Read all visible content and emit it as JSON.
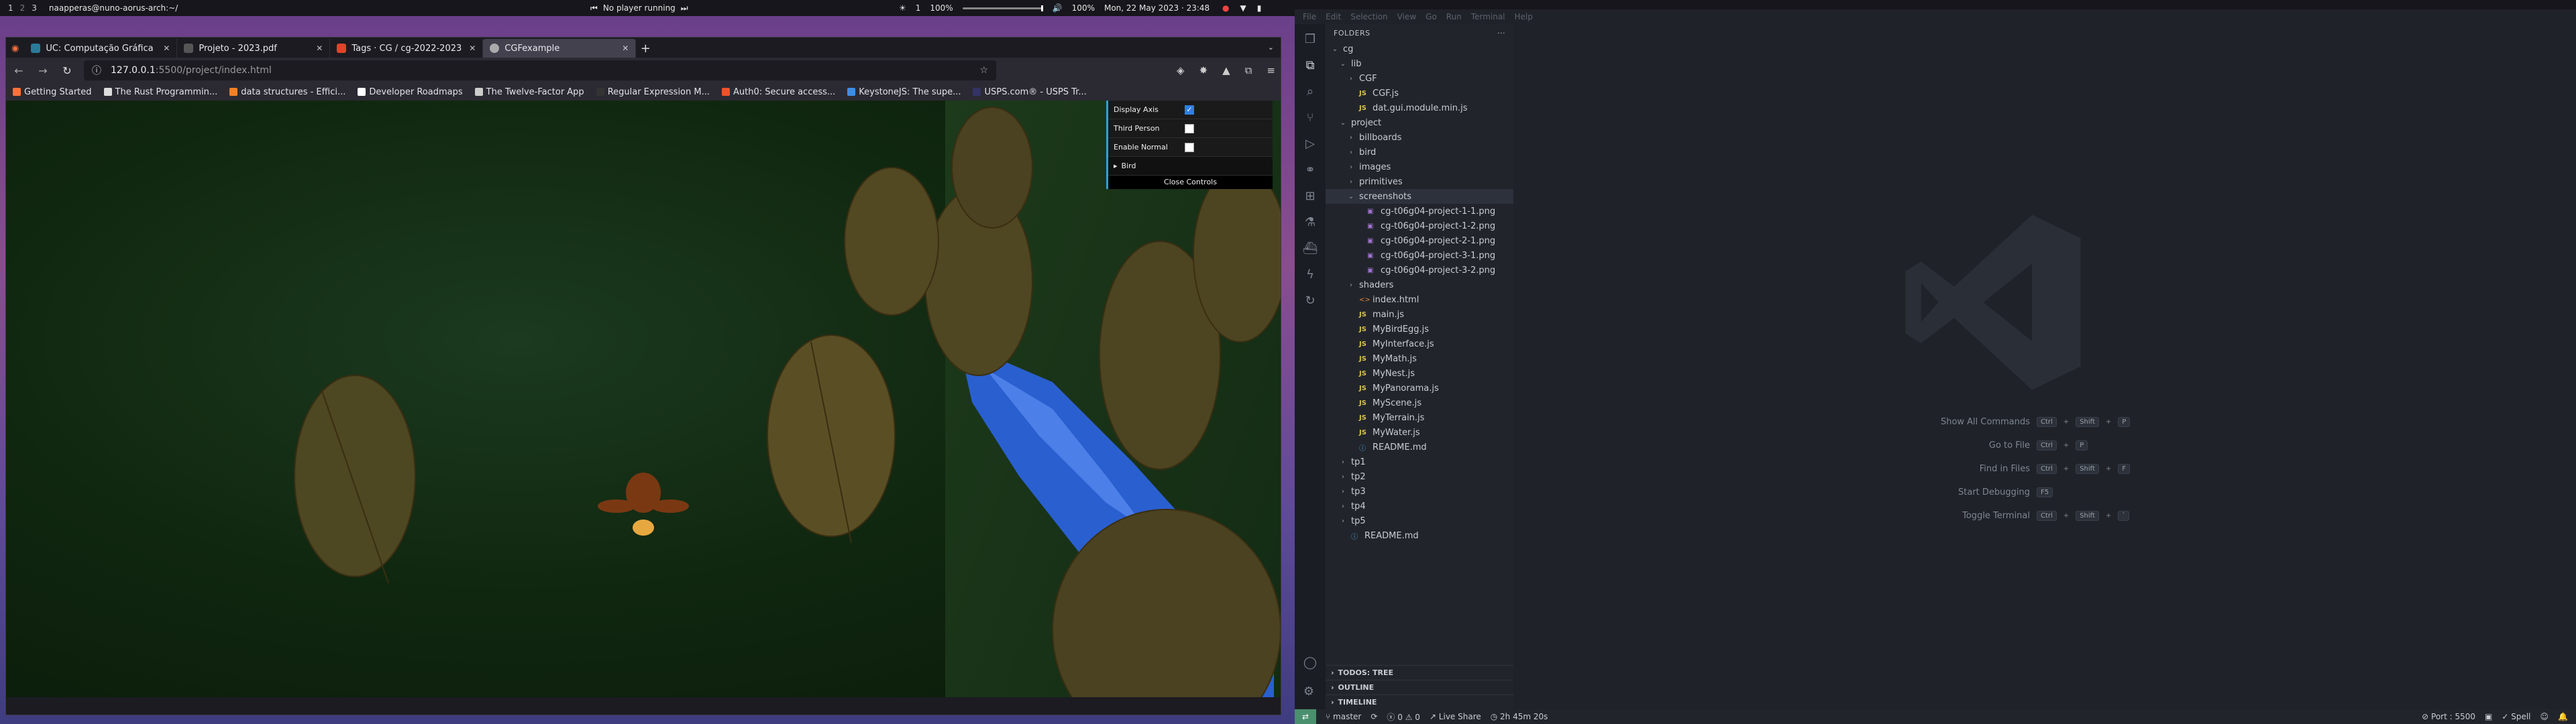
{
  "topbar": {
    "workspaces": [
      "1",
      "2",
      "3"
    ],
    "window_title": "naapperas@nuno-aorus-arch:~/",
    "media": "No player running",
    "brightness_value": "1",
    "brightness_pct": "100%",
    "volume_pct": "100%",
    "datetime": "Mon, 22 May 2023 · 23:48",
    "volume_level": 1.0
  },
  "browser": {
    "tabs": [
      {
        "label": "UC: Computação Gráfica",
        "favicon": "ucl-icon",
        "color": "#2b7a9a"
      },
      {
        "label": "Projeto - 2023.pdf",
        "favicon": "pdf-icon",
        "color": "#555"
      },
      {
        "label": "Tags · CG / cg-2022-2023",
        "favicon": "gitlab-icon",
        "color": "#e2432a"
      },
      {
        "label": "CGFexample",
        "favicon": "globe-icon",
        "color": "#aaa"
      }
    ],
    "url_host": "127.0.0.1",
    "url_rest": ":5500/project/index.html",
    "bookmarks": [
      {
        "label": "Getting Started",
        "color": "#ff7139"
      },
      {
        "label": "The Rust Programmin...",
        "color": "#ddd"
      },
      {
        "label": "data structures - Effici...",
        "color": "#f48024"
      },
      {
        "label": "Developer Roadmaps",
        "color": "#fff"
      },
      {
        "label": "The Twelve-Factor App",
        "color": "#ccc"
      },
      {
        "label": "Regular Expression M...",
        "color": "#333"
      },
      {
        "label": "Auth0: Secure access...",
        "color": "#eb5424"
      },
      {
        "label": "KeystoneJS: The supe...",
        "color": "#3c8de6"
      },
      {
        "label": "USPS.com® - USPS Tr...",
        "color": "#333366"
      }
    ]
  },
  "gui": {
    "rows": [
      {
        "label": "Display Axis",
        "checked": true
      },
      {
        "label": "Third Person",
        "checked": false
      },
      {
        "label": "Enable Normal",
        "checked": false
      }
    ],
    "folder": "Bird",
    "close_label": "Close Controls"
  },
  "vscode": {
    "menu": [
      "File",
      "Edit",
      "Selection",
      "View",
      "Go",
      "Run",
      "Terminal",
      "Help"
    ],
    "sidebar_title": "FOLDERS",
    "tree": [
      {
        "label": "cg",
        "depth": 0,
        "type": "folder-open"
      },
      {
        "label": "lib",
        "depth": 1,
        "type": "folder-open"
      },
      {
        "label": "CGF",
        "depth": 2,
        "type": "folder"
      },
      {
        "label": "CGF.js",
        "depth": 2,
        "type": "js"
      },
      {
        "label": "dat.gui.module.min.js",
        "depth": 2,
        "type": "js"
      },
      {
        "label": "project",
        "depth": 1,
        "type": "folder-open"
      },
      {
        "label": "billboards",
        "depth": 2,
        "type": "folder"
      },
      {
        "label": "bird",
        "depth": 2,
        "type": "folder"
      },
      {
        "label": "images",
        "depth": 2,
        "type": "folder"
      },
      {
        "label": "primitives",
        "depth": 2,
        "type": "folder"
      },
      {
        "label": "screenshots",
        "depth": 2,
        "type": "folder-open",
        "selected": true
      },
      {
        "label": "cg-t06g04-project-1-1.png",
        "depth": 3,
        "type": "png"
      },
      {
        "label": "cg-t06g04-project-1-2.png",
        "depth": 3,
        "type": "png"
      },
      {
        "label": "cg-t06g04-project-2-1.png",
        "depth": 3,
        "type": "png"
      },
      {
        "label": "cg-t06g04-project-3-1.png",
        "depth": 3,
        "type": "png"
      },
      {
        "label": "cg-t06g04-project-3-2.png",
        "depth": 3,
        "type": "png"
      },
      {
        "label": "shaders",
        "depth": 2,
        "type": "folder"
      },
      {
        "label": "index.html",
        "depth": 2,
        "type": "html"
      },
      {
        "label": "main.js",
        "depth": 2,
        "type": "js"
      },
      {
        "label": "MyBirdEgg.js",
        "depth": 2,
        "type": "js"
      },
      {
        "label": "MyInterface.js",
        "depth": 2,
        "type": "js"
      },
      {
        "label": "MyMath.js",
        "depth": 2,
        "type": "js"
      },
      {
        "label": "MyNest.js",
        "depth": 2,
        "type": "js"
      },
      {
        "label": "MyPanorama.js",
        "depth": 2,
        "type": "js"
      },
      {
        "label": "MyScene.js",
        "depth": 2,
        "type": "js"
      },
      {
        "label": "MyTerrain.js",
        "depth": 2,
        "type": "js"
      },
      {
        "label": "MyWater.js",
        "depth": 2,
        "type": "js"
      },
      {
        "label": "README.md",
        "depth": 2,
        "type": "md"
      },
      {
        "label": "tp1",
        "depth": 1,
        "type": "folder"
      },
      {
        "label": "tp2",
        "depth": 1,
        "type": "folder"
      },
      {
        "label": "tp3",
        "depth": 1,
        "type": "folder"
      },
      {
        "label": "tp4",
        "depth": 1,
        "type": "folder"
      },
      {
        "label": "tp5",
        "depth": 1,
        "type": "folder"
      },
      {
        "label": "README.md",
        "depth": 1,
        "type": "md"
      }
    ],
    "panels": [
      "TODOS: TREE",
      "OUTLINE",
      "TIMELINE"
    ],
    "hints": [
      {
        "label": "Show All Commands",
        "keys": [
          "Ctrl",
          "Shift",
          "P"
        ]
      },
      {
        "label": "Go to File",
        "keys": [
          "Ctrl",
          "P"
        ]
      },
      {
        "label": "Find in Files",
        "keys": [
          "Ctrl",
          "Shift",
          "F"
        ]
      },
      {
        "label": "Start Debugging",
        "keys": [
          "F5"
        ]
      },
      {
        "label": "Toggle Terminal",
        "keys": [
          "Ctrl",
          "Shift",
          "`"
        ]
      }
    ],
    "status": {
      "branch": "master",
      "problems": "0",
      "warnings": "0",
      "liveshare": "Live Share",
      "time": "2h 45m 20s",
      "port": "Port : 5500",
      "spell": "Spell"
    }
  }
}
